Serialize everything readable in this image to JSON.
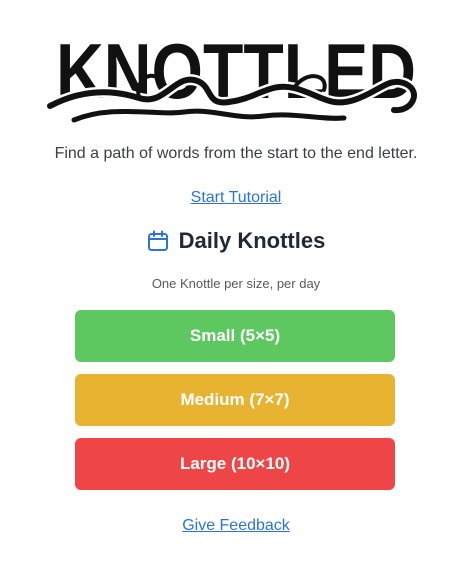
{
  "logo": {
    "text": "KNOTTLED"
  },
  "tagline": "Find a path of words from the start to the end letter.",
  "tutorial_link": "Start Tutorial",
  "daily": {
    "title": "Daily Knottles",
    "subtitle": "One Knottle per size, per day",
    "icon": "calendar-icon",
    "accent": "#2b74e0"
  },
  "sizes": [
    {
      "label": "Small (5×5)",
      "color": "#5cc85f"
    },
    {
      "label": "Medium (7×7)",
      "color": "#e8b330"
    },
    {
      "label": "Large (10×10)",
      "color": "#ee4646"
    }
  ],
  "feedback_link": "Give Feedback"
}
